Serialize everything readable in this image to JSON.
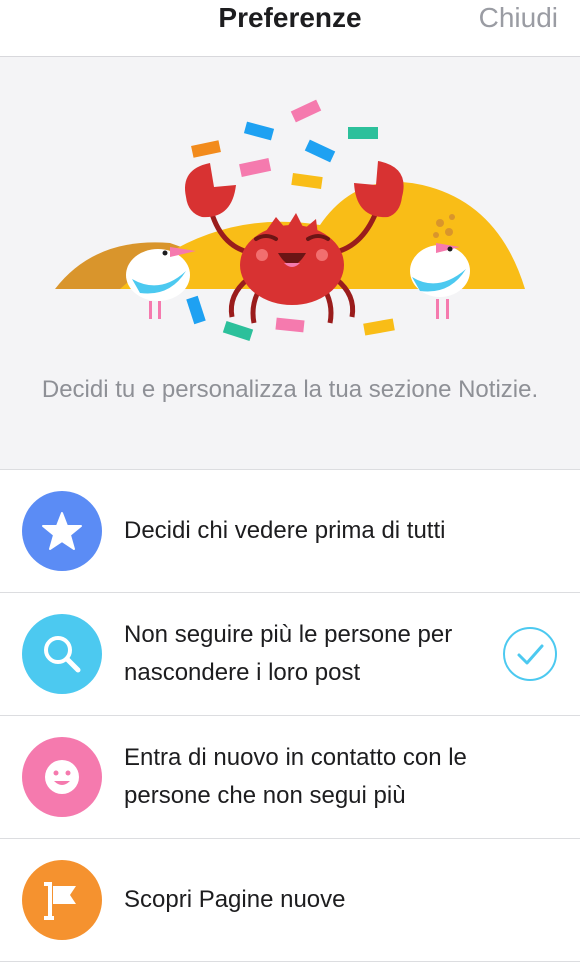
{
  "nav": {
    "title": "Preferenze",
    "close_label": "Chiudi"
  },
  "hero": {
    "text": "Decidi tu e personalizza la tua sezione Notizie."
  },
  "options": [
    {
      "label": "Decidi chi vedere prima di tutti",
      "icon": "star-icon",
      "color": "#5b8cf5",
      "checked": false
    },
    {
      "label": "Non seguire più le persone per nascondere i loro post",
      "icon": "search-icon",
      "color": "#4cc9f0",
      "checked": true
    },
    {
      "label": "Entra di nuovo in contatto con le persone che non segui più",
      "icon": "smiley-icon",
      "color": "#f57aae",
      "checked": false
    },
    {
      "label": "Scopri Pagine nuove",
      "icon": "flag-icon",
      "color": "#f5922f",
      "checked": false
    }
  ],
  "colors": {
    "check_accent": "#4cc9f0"
  }
}
